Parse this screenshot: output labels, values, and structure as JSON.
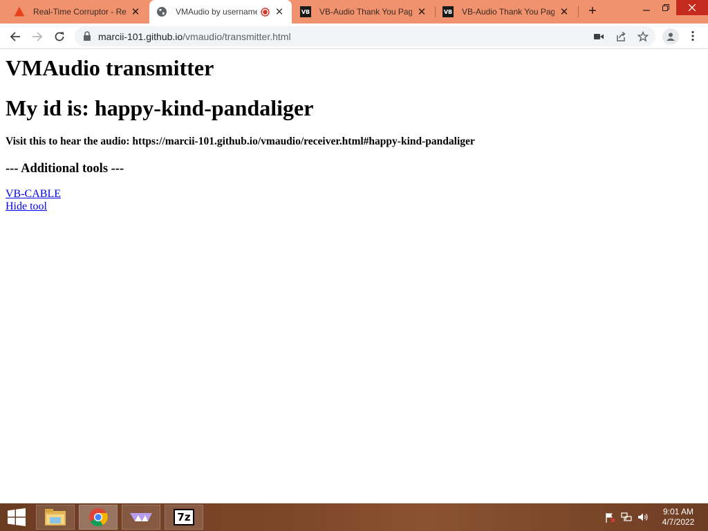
{
  "browser": {
    "tabs": [
      {
        "title": "Real-Time Corruptor - Red",
        "favicon": "warning-triangle-icon",
        "active": false
      },
      {
        "title": "VMAudio by username",
        "favicon": "globe-icon",
        "active": true,
        "recording": true
      },
      {
        "title": "VB-Audio Thank You Page",
        "favicon": "vb-audio-icon",
        "active": false
      },
      {
        "title": "VB-Audio Thank You Page",
        "favicon": "vb-audio-icon",
        "active": false
      }
    ],
    "new_tab_label": "+",
    "favicon_text": "VB",
    "url_host": "marcii-101.github.io",
    "url_path": "/vmaudio/transmitter.html"
  },
  "page": {
    "title": "VMAudio transmitter",
    "id_heading": "My id is: happy-kind-pandaliger",
    "visit_text": "Visit this to hear the audio: https://marcii-101.github.io/vmaudio/receiver.html#happy-kind-pandaliger",
    "tools_heading": "--- Additional tools ---",
    "links": [
      "VB-CABLE",
      "Hide tool"
    ]
  },
  "taskbar": {
    "apps": [
      "file-explorer-icon",
      "chrome-icon",
      "vmaudio-app-icon",
      "7zip-icon"
    ],
    "seven_zip_label": "7z",
    "time": "9:01 AM",
    "date": "4/7/2022"
  },
  "colors": {
    "tab_strip": "#f0926d",
    "link": "#0000ee",
    "record_dot": "#d93025",
    "warning_triangle": "#e8401c"
  }
}
